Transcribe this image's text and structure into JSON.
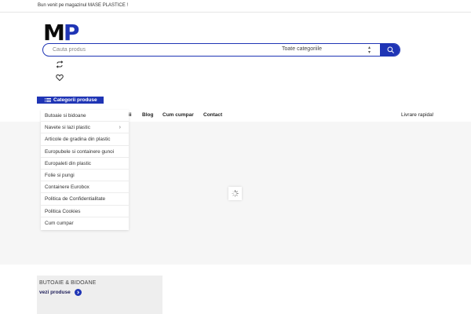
{
  "topbar": {
    "welcome": "Bun venit pe magazinul MASE PLASTICE !"
  },
  "logo": {
    "m": "M",
    "p": "P"
  },
  "search": {
    "placeholder": "Cauta produs",
    "category_selected": "Toate categoriile",
    "button_icon": "search-icon"
  },
  "icons": {
    "compare": "repeat-icon",
    "wishlist": "heart-icon"
  },
  "categories": {
    "header": "Categorii produse",
    "items": [
      {
        "label": "Butoaie si bidoane"
      },
      {
        "label": "Navete si lazi plastic"
      },
      {
        "label": "Articole de gradina din plastic"
      },
      {
        "label": "Europubele si containere gunoi"
      },
      {
        "label": "Europaleti din plastic"
      },
      {
        "label": "Folie si pungi"
      },
      {
        "label": "Containere Eurobox"
      },
      {
        "label": "Politica de Confidentialitate"
      },
      {
        "label": "Politica Cookies"
      },
      {
        "label": "Cum cumpar"
      }
    ]
  },
  "nav": {
    "partial": "ii",
    "blog": "Blog",
    "cum_cumpar": "Cum cumpar",
    "contact": "Contact",
    "delivery": "Livrare rapida!"
  },
  "promo": {
    "title": "BUTOAIE & BIDOANE",
    "link": "vezi produse"
  },
  "colors": {
    "accent": "#1f35b5",
    "slider_bg": "#f6f6f6",
    "promo_bg": "#eeeeee"
  }
}
